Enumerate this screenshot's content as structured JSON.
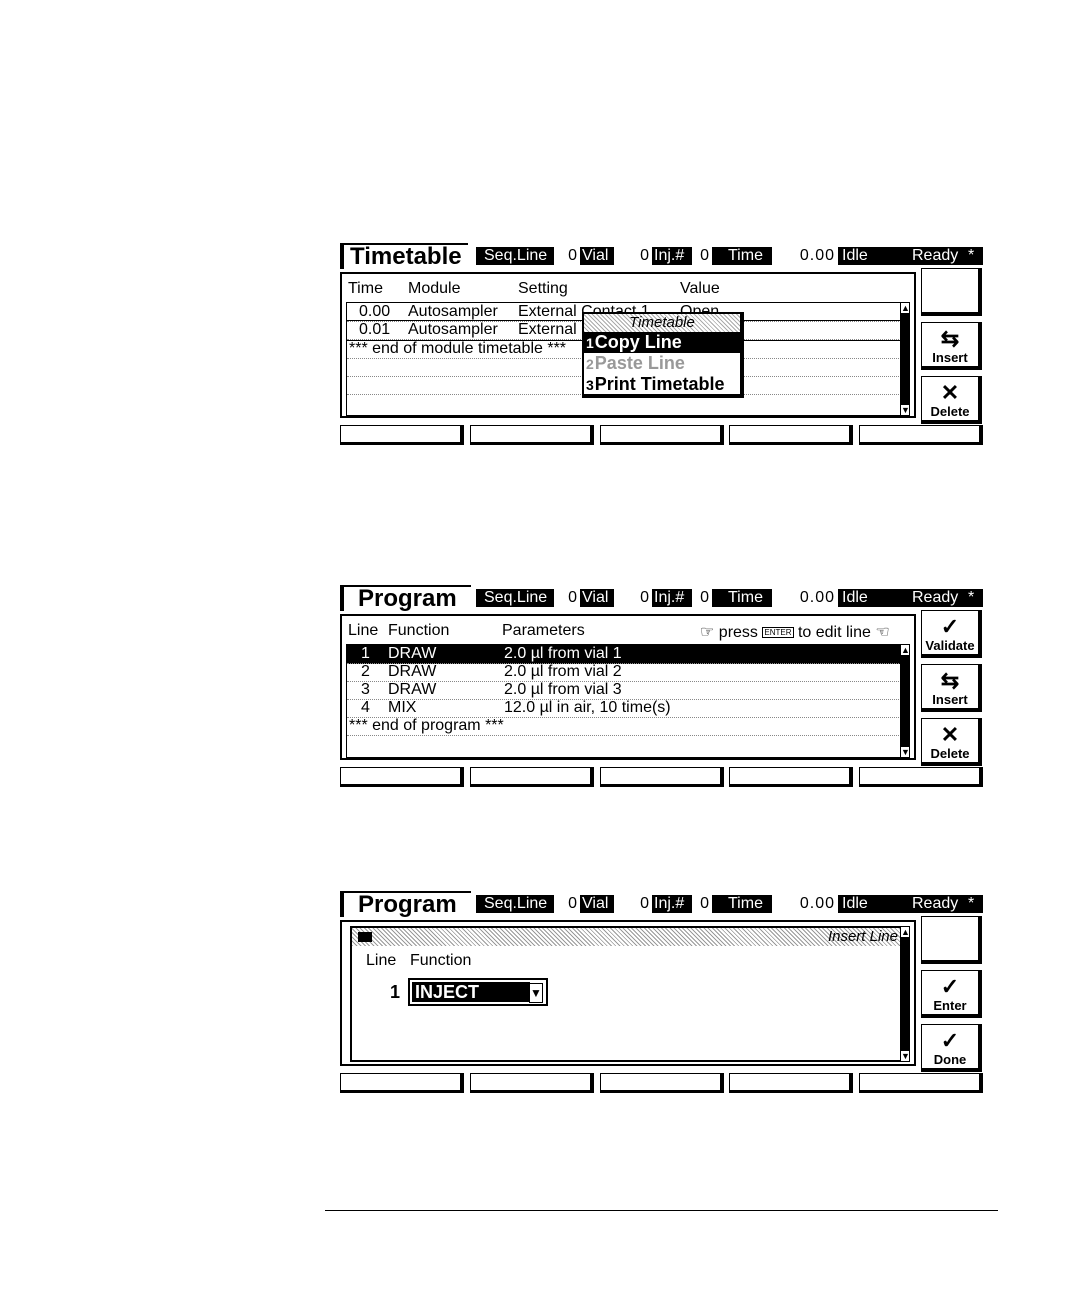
{
  "status": {
    "seq_label": "Seq.Line",
    "seq_val": "0",
    "vial_label": "Vial",
    "vial_val": "0",
    "inj_label": "Inj.#",
    "inj_val": "0",
    "time_label": "Time",
    "time_val": "0.00",
    "state": "Idle",
    "ready": "Ready",
    "star": "*"
  },
  "screen1": {
    "title": "Timetable",
    "col_time": "Time",
    "col_module": "Module",
    "col_setting": "Setting",
    "col_value": "Value",
    "rows": [
      {
        "time": "0.00",
        "module": "Autosampler",
        "setting": "External Contact 1",
        "value": "Open"
      },
      {
        "time": "0.01",
        "module": "Autosampler",
        "setting": "External"
      }
    ],
    "end_text": "*** end of module timetable ***",
    "popup": {
      "title": "Timetable",
      "items": [
        {
          "num": "1",
          "label": "Copy Line"
        },
        {
          "num": "2",
          "label": "Paste Line"
        },
        {
          "num": "3",
          "label": "Print Timetable"
        }
      ]
    },
    "side": {
      "insert": "Insert",
      "delete": "Delete"
    }
  },
  "screen2": {
    "title": "Program",
    "col_line": "Line",
    "col_function": "Function",
    "col_params": "Parameters",
    "hint_press": "press",
    "hint_key": "ENTER",
    "hint_edit": "to edit line",
    "rows": [
      {
        "line": "1",
        "function": "DRAW",
        "params": "2.0 µl from vial 1"
      },
      {
        "line": "2",
        "function": "DRAW",
        "params": "2.0 µl from vial 2"
      },
      {
        "line": "3",
        "function": "DRAW",
        "params": "2.0 µl from vial 3"
      },
      {
        "line": "4",
        "function": "MIX",
        "params": "12.0 µl in air, 10 time(s)"
      }
    ],
    "end_text": "*** end of program ***",
    "side": {
      "validate": "Validate",
      "insert": "Insert",
      "delete": "Delete"
    }
  },
  "screen3": {
    "title": "Program",
    "dialog_title": "Insert Line",
    "col_line": "Line",
    "col_function": "Function",
    "line_val": "1",
    "function_val": "INJECT",
    "side": {
      "enter": "Enter",
      "done": "Done"
    }
  }
}
